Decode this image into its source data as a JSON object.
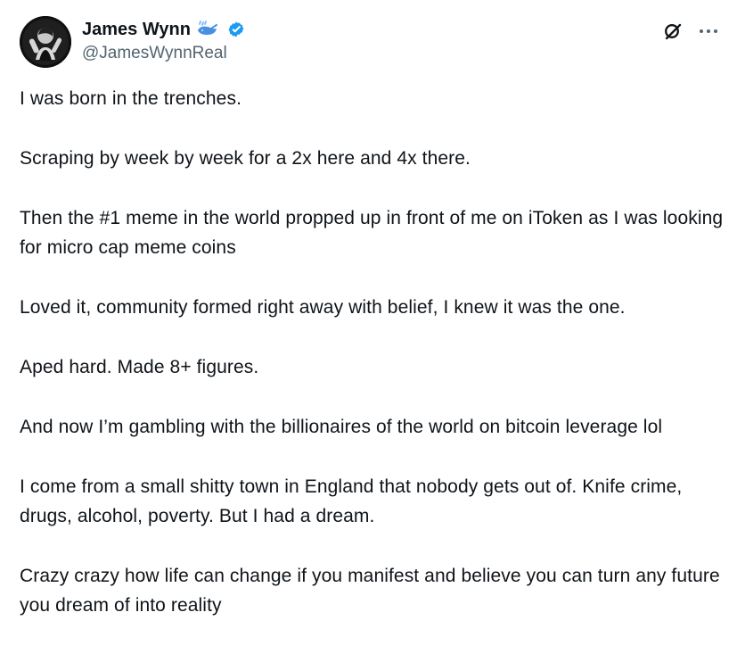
{
  "author": {
    "display_name": "James Wynn",
    "handle": "@JamesWynnReal"
  },
  "icons": {
    "whale": "whale-icon",
    "verified": "verified-badge-icon",
    "grok": "grok-icon",
    "more": "more-options-icon",
    "avatar": "profile-photo"
  },
  "colors": {
    "text": "#0f1419",
    "secondary_text": "#536471",
    "verified": "#1d9bf0",
    "background": "#ffffff"
  },
  "tweet": {
    "paragraphs": [
      "I was born in the trenches.",
      "Scraping by week by week for a 2x here and 4x there.",
      "Then the #1 meme in the world propped up in front of me on iToken as I was looking for micro cap meme coins",
      "Loved it, community formed right away with belief, I knew it was the one.",
      "Aped hard. Made 8+ figures.",
      "And now I’m gambling with the billionaires of the world on bitcoin leverage lol",
      "I come from a small shitty town in England that nobody gets out of. Knife crime, drugs, alcohol, poverty. But I had a dream.",
      "Crazy crazy how life can change if you manifest and believe you can turn any future you dream of into reality"
    ]
  }
}
